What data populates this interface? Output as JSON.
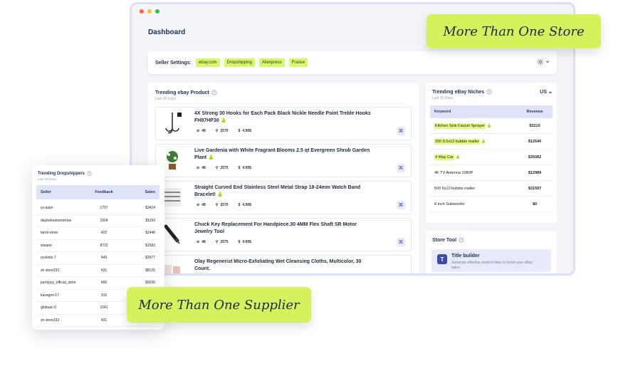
{
  "colors": {
    "accent_lime": "#d4f25c",
    "tag_lime": "#d7f76d",
    "header_blue": "#dfe3f8",
    "navy": "#1f2d5a",
    "window_border": "#dcdff7"
  },
  "window": {
    "traffic_lights": [
      "#ff5f57",
      "#febc2e",
      "#28c840"
    ],
    "title": "Dashboard"
  },
  "settings": {
    "label": "Seller Settings:",
    "tags": [
      "ebay.com",
      "Dropshipping",
      "Aliexpress",
      "France"
    ],
    "gear_icon": "gear-icon"
  },
  "products": {
    "title": "Trending ebay Product",
    "subtitle": "Last 30 Days",
    "items": [
      {
        "name": "4X Strong 30 Hooks for Each Pack Black Nickle Needle Point Treble Hooks FH87HP30",
        "tag": "48",
        "searches": "2575",
        "price": "4.99$",
        "thumb": "hook"
      },
      {
        "name": "Live Gardenia with White Fragrant Blooms 2.5 qt Evergreen Shrub Garden Plant",
        "tag": "48",
        "searches": "2575",
        "price": "4.99$",
        "thumb": "plant"
      },
      {
        "name": "Straight Curved End Stainless Steel Metal Strap 18-24mm Watch Band Bracelet!",
        "tag": "48",
        "searches": "2575",
        "price": "4.99$",
        "thumb": "strap"
      },
      {
        "name": "Chuck Key Replacement For Handpiece.30 4MM Flex Shaft SR Motor Jewelry Tool",
        "tag": "48",
        "searches": "2575",
        "price": "4.99$",
        "thumb": "tool"
      },
      {
        "name": "Olay Regenerist Micro-Exfoliating Wet Cleansing Cloths, Multicolor, 30 Count.",
        "thumb": "olay"
      }
    ]
  },
  "niches": {
    "title": "Trending eBay Niches",
    "subtitle": "Last 30 Days",
    "country": "US",
    "headers": [
      "Keyword",
      "Revenue"
    ],
    "rows": [
      {
        "keyword": "Kitchen Sink Faucet Sprayer",
        "revenue": "$3210",
        "highlight": true
      },
      {
        "keyword": "200 8.5x12 bubble mailer",
        "revenue": "$12540",
        "highlight": true
      },
      {
        "keyword": "4 Way Car",
        "revenue": "$35082",
        "highlight": true
      },
      {
        "keyword": "4K TV Antenna 1080P",
        "revenue": "$12989",
        "highlight": false
      },
      {
        "keyword": "500 6x10 bubble mailer",
        "revenue": "$31597",
        "highlight": false
      },
      {
        "keyword": "8 inch Subwoofer",
        "revenue": "$0",
        "highlight": false
      }
    ]
  },
  "store_tool": {
    "title": "Store Tool",
    "builder_title": "Title builder",
    "builder_desc": "Generate effective product titles to boost your eBay sales."
  },
  "badges": {
    "store": "More Than One Store",
    "supplier": "More Than One Supplier"
  },
  "dropshippers": {
    "title": "Trending Dropshippers",
    "subtitle": "Last 30 Days",
    "headers": [
      "Seller",
      "Feedback",
      "Sales"
    ],
    "rows": [
      {
        "seller": "ys-astor",
        "feedback": "1797",
        "sales": "$3424"
      },
      {
        "seller": "daybeforetomorrow",
        "feedback": "1504",
        "sales": "$1159"
      },
      {
        "seller": "taron-store",
        "feedback": "422",
        "sales": "$2448"
      },
      {
        "seller": "siwarel",
        "feedback": "8722",
        "sales": "$1583"
      },
      {
        "seller": "rocknits-7",
        "feedback": "449",
        "sales": "$3977"
      },
      {
        "seller": "sh store333",
        "feedback": "431",
        "sales": "$8125"
      },
      {
        "seller": "purnjoyy_official_store",
        "feedback": "466",
        "sales": "$9036"
      },
      {
        "seller": "kavegim-17",
        "feedback": "315",
        "sales": ""
      },
      {
        "seller": "globuac-0",
        "feedback": "1041",
        "sales": ""
      },
      {
        "seller": "sh store333",
        "feedback": "431",
        "sales": ""
      }
    ]
  }
}
